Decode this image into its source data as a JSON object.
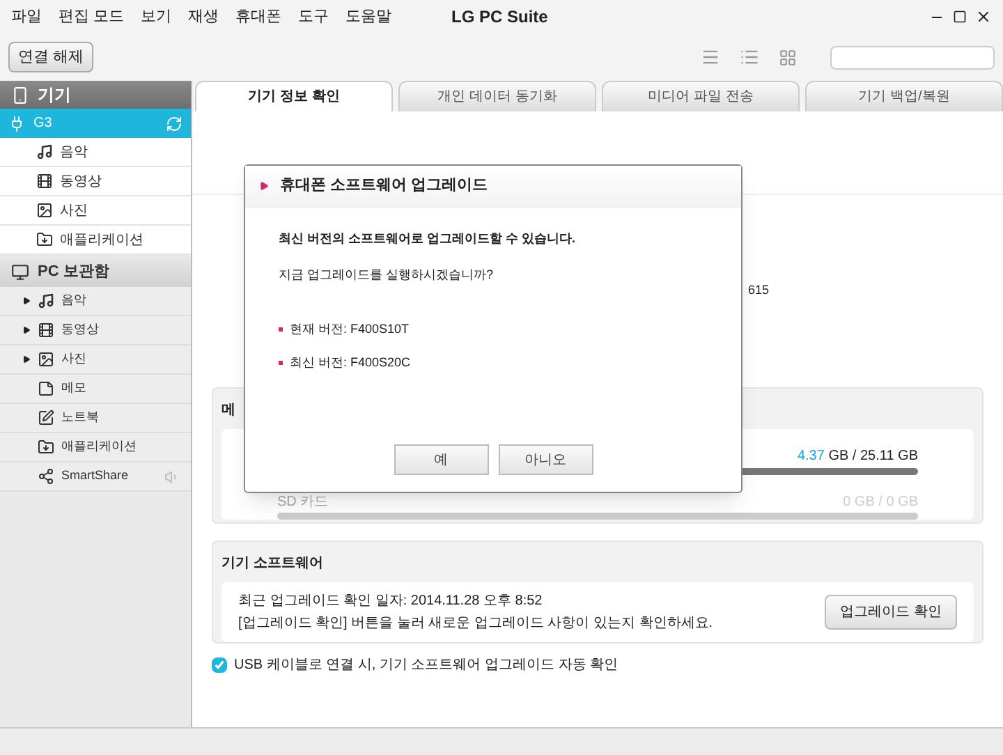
{
  "window": {
    "title": "LG PC Suite"
  },
  "menu": [
    "파일",
    "편집 모드",
    "보기",
    "재생",
    "휴대폰",
    "도구",
    "도움말"
  ],
  "toolbar": {
    "disconnect_button": "연결 해제"
  },
  "sidebar": {
    "device_header": "기기",
    "device": {
      "label": "G3",
      "selected": true
    },
    "device_items": [
      {
        "label": "음악",
        "kind": "music"
      },
      {
        "label": "동영상",
        "kind": "video"
      },
      {
        "label": "사진",
        "kind": "photo"
      },
      {
        "label": "애플리케이션",
        "kind": "app"
      }
    ],
    "pc_header": "PC 보관함",
    "pc_items": [
      {
        "label": "음악",
        "kind": "music",
        "expandable": true
      },
      {
        "label": "동영상",
        "kind": "video",
        "expandable": true
      },
      {
        "label": "사진",
        "kind": "photo",
        "expandable": true
      },
      {
        "label": "메모",
        "kind": "memo",
        "expandable": false
      },
      {
        "label": "노트북",
        "kind": "note",
        "expandable": false
      },
      {
        "label": "애플리케이션",
        "kind": "app",
        "expandable": false
      },
      {
        "label": "SmartShare",
        "kind": "share",
        "expandable": false
      }
    ]
  },
  "tabs": [
    {
      "label": "기기 정보 확인",
      "selected": true
    },
    {
      "label": "개인 데이터 동기화",
      "selected": false
    },
    {
      "label": "미디어 파일 전송",
      "selected": false
    },
    {
      "label": "기기 백업/복원",
      "selected": false
    }
  ],
  "info_text": "615",
  "memory": {
    "title": "메",
    "internal": {
      "used": "4.37",
      "rest": " GB / 25.11 GB"
    },
    "sd": {
      "label": "SD 카드",
      "reading": "0 GB / 0 GB"
    }
  },
  "software": {
    "title": "기기 소프트웨어",
    "last_check": "최근 업그레이드 확인 일자: 2014.11.28 오후 8:52",
    "hint": "[업그레이드 확인] 버튼을 눌러 새로운 업그레이드 사항이 있는지 확인하세요.",
    "button": "업그레이드 확인"
  },
  "auto_check": {
    "label": "USB 케이블로 연결 시, 기기 소프트웨어 업그레이드 자동 확인",
    "checked": true
  },
  "dialog": {
    "title": "휴대폰 소프트웨어 업그레이드",
    "message": "최신 버전의 소프트웨어로 업그레이드할 수 있습니다.",
    "question": "지금 업그레이드를 실행하시겠습니까?",
    "versions": [
      "현재 버전: F400S10T",
      "최신 버전: F400S20C"
    ],
    "buttons": [
      "예",
      "아니오"
    ]
  }
}
